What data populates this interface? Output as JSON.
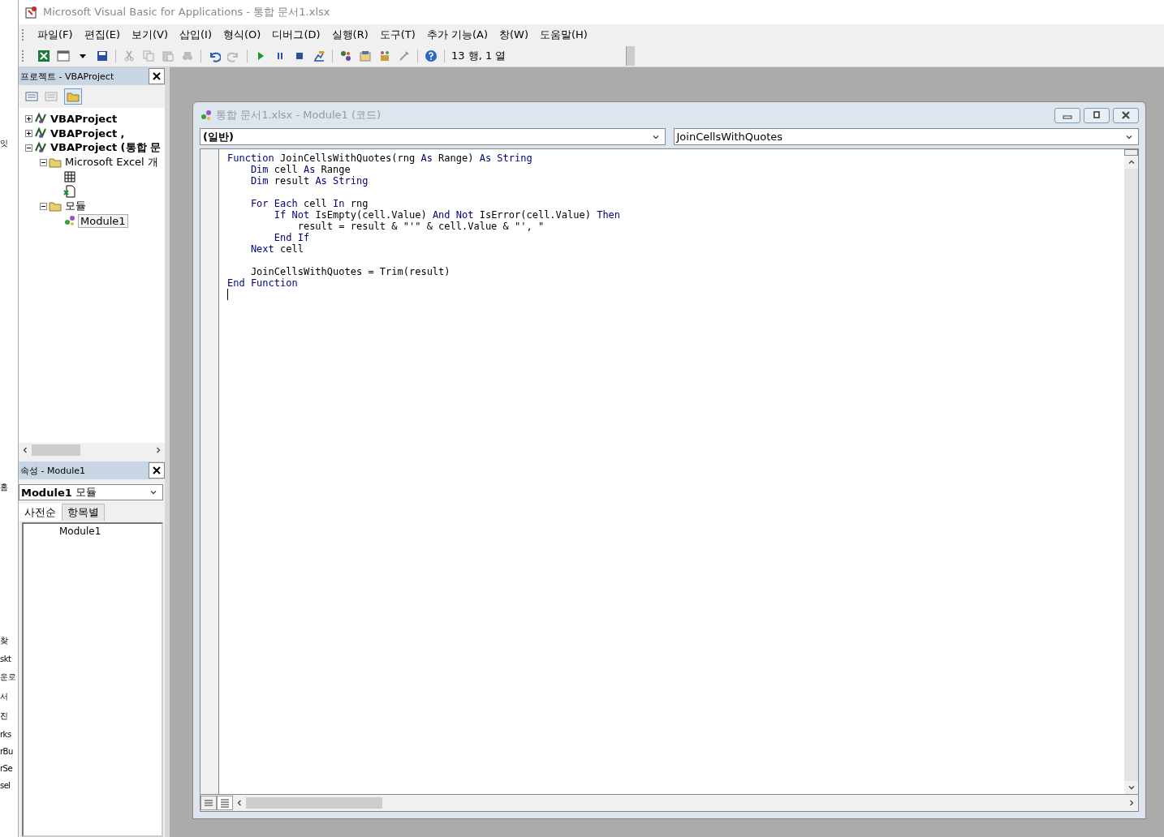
{
  "window": {
    "title": "Microsoft Visual Basic for Applications - 통합 문서1.xlsx"
  },
  "menu": [
    {
      "label": "파일(F)"
    },
    {
      "label": "편집(E)"
    },
    {
      "label": "보기(V)"
    },
    {
      "label": "삽입(I)"
    },
    {
      "label": "형식(O)"
    },
    {
      "label": "디버그(D)"
    },
    {
      "label": "실행(R)"
    },
    {
      "label": "도구(T)"
    },
    {
      "label": "추가 기능(A)"
    },
    {
      "label": "창(W)"
    },
    {
      "label": "도움말(H)"
    }
  ],
  "toolbar": {
    "position": "13 행, 1 열"
  },
  "background_window_fragments": [
    {
      "text": "잇"
    },
    {
      "text": "홈"
    },
    {
      "text": "찾"
    },
    {
      "text": "skt"
    },
    {
      "text": "운로"
    },
    {
      "text": "서"
    },
    {
      "text": "진"
    },
    {
      "text": "rks"
    },
    {
      "text": "rBu"
    },
    {
      "text": "rSe"
    },
    {
      "text": "sel"
    }
  ],
  "project_panel": {
    "title": "프로젝트 - VBAProject",
    "tree": [
      {
        "label": "VBAProject",
        "kind": "project",
        "expanded": false,
        "selected": false
      },
      {
        "label": "VBAProject ,",
        "kind": "project",
        "expanded": false,
        "selected": false
      },
      {
        "label": "VBAProject (통합 문",
        "kind": "project",
        "expanded": true,
        "selected": false,
        "children": [
          {
            "label": "Microsoft Excel 개",
            "kind": "folder",
            "expanded": true,
            "selected": false,
            "children": [
              {
                "kind": "sheet",
                "selected": false
              },
              {
                "kind": "workbook",
                "selected": false
              }
            ]
          },
          {
            "label": "모듈",
            "kind": "folder",
            "expanded": true,
            "selected": false,
            "children": [
              {
                "label": "Module1",
                "kind": "module",
                "selected": true
              }
            ]
          }
        ]
      }
    ]
  },
  "properties_panel": {
    "title": "속성 - Module1",
    "object": {
      "name": "Module1",
      "type": "모듈"
    },
    "tabs": [
      {
        "label": "사전순",
        "selected": true
      },
      {
        "label": "항목별",
        "selected": false
      }
    ],
    "rows": [
      {
        "value": "Module1"
      }
    ]
  },
  "code_window": {
    "title": "통합 문서1.xlsx - Module1 (코드)",
    "object_dropdown": "(일반)",
    "procedure_dropdown": "JoinCellsWithQuotes",
    "lines": [
      {
        "kind": "code",
        "segments": [
          {
            "kind": "keyword",
            "text": "Function"
          },
          {
            "kind": "plain",
            "text": " JoinCellsWithQuotes(rng "
          },
          {
            "kind": "keyword",
            "text": "As"
          },
          {
            "kind": "plain",
            "text": " Range) "
          },
          {
            "kind": "keyword",
            "text": "As String"
          }
        ]
      },
      {
        "kind": "code",
        "segments": [
          {
            "kind": "keyword",
            "text": "    Dim"
          },
          {
            "kind": "plain",
            "text": " cell "
          },
          {
            "kind": "keyword",
            "text": "As"
          },
          {
            "kind": "plain",
            "text": " Range"
          }
        ]
      },
      {
        "kind": "code",
        "segments": [
          {
            "kind": "keyword",
            "text": "    Dim"
          },
          {
            "kind": "plain",
            "text": " result "
          },
          {
            "kind": "keyword",
            "text": "As String"
          }
        ]
      },
      {
        "kind": "blank"
      },
      {
        "kind": "code",
        "segments": [
          {
            "kind": "keyword",
            "text": "    For Each"
          },
          {
            "kind": "plain",
            "text": " cell "
          },
          {
            "kind": "keyword",
            "text": "In"
          },
          {
            "kind": "plain",
            "text": " rng"
          }
        ]
      },
      {
        "kind": "code",
        "segments": [
          {
            "kind": "keyword",
            "text": "        If Not"
          },
          {
            "kind": "plain",
            "text": " IsEmpty(cell.Value) "
          },
          {
            "kind": "keyword",
            "text": "And Not"
          },
          {
            "kind": "plain",
            "text": " IsError(cell.Value) "
          },
          {
            "kind": "keyword",
            "text": "Then"
          }
        ]
      },
      {
        "kind": "code",
        "segments": [
          {
            "kind": "plain",
            "text": "            result = result & \"'\" & cell.Value & \"', \""
          }
        ]
      },
      {
        "kind": "code",
        "segments": [
          {
            "kind": "keyword",
            "text": "        End If"
          }
        ]
      },
      {
        "kind": "code",
        "segments": [
          {
            "kind": "keyword",
            "text": "    Next"
          },
          {
            "kind": "plain",
            "text": " cell"
          }
        ]
      },
      {
        "kind": "blank"
      },
      {
        "kind": "code",
        "segments": [
          {
            "kind": "plain",
            "text": "    JoinCellsWithQuotes = Trim(result)"
          }
        ]
      },
      {
        "kind": "code",
        "segments": [
          {
            "kind": "keyword",
            "text": "End Function"
          }
        ]
      }
    ]
  }
}
